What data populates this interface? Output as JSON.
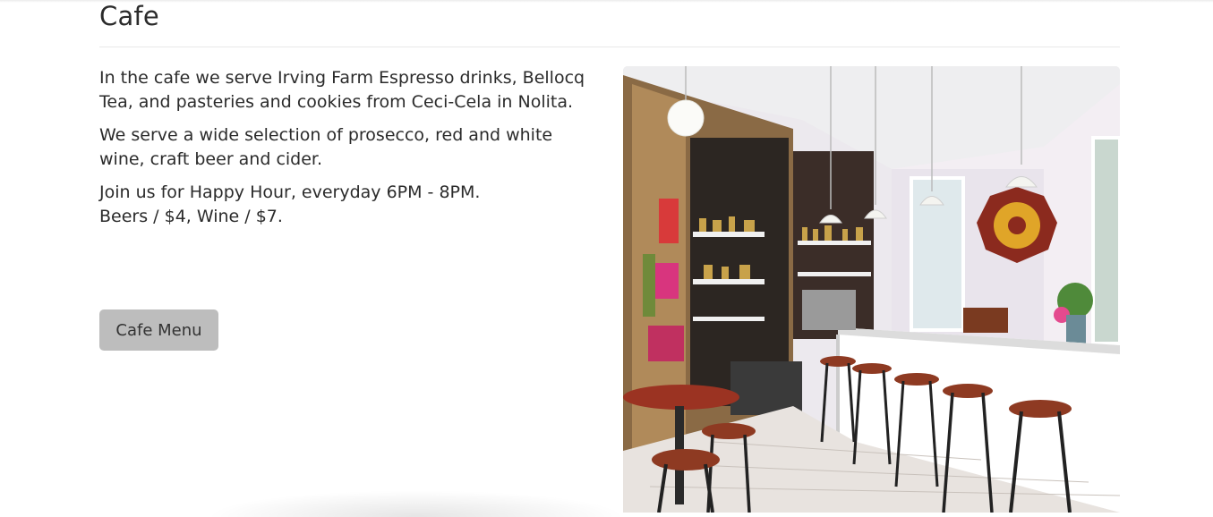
{
  "section": {
    "title": "Cafe"
  },
  "content": {
    "paragraphs": [
      "In the cafe we serve Irving Farm Espresso drinks, Bellocq Tea, and pasteries and cookies from Ceci-Cela in Nolita.",
      "We serve a wide selection of prosecco, red and white wine, craft beer and cider."
    ],
    "happy_hour_line1": "Join us for Happy Hour, everyday 6PM - 8PM.",
    "happy_hour_line2": "Beers / $4, Wine / $7."
  },
  "button": {
    "label": "Cafe Menu"
  },
  "photo": {
    "subject": "cafe interior with bar stools"
  }
}
